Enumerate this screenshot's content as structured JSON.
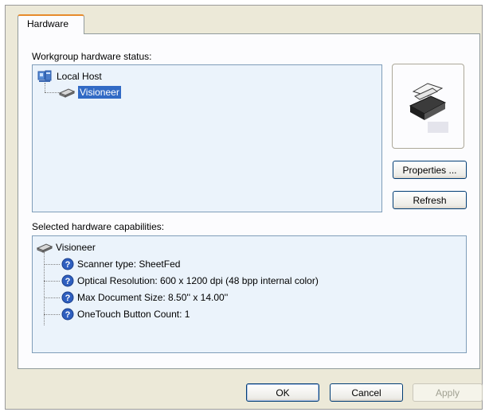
{
  "tabs": [
    {
      "label": "Hardware"
    }
  ],
  "status_section": {
    "label": "Workgroup hardware status:",
    "tree": {
      "root": {
        "label": "Local Host",
        "icon": "network-host-icon"
      },
      "child": {
        "label": "Visioneer",
        "icon": "scanner-icon"
      }
    }
  },
  "device_image": {
    "icon": "sheetfed-scanner-icon"
  },
  "side_buttons": {
    "properties": "Properties ...",
    "refresh": "Refresh"
  },
  "capabilities_section": {
    "label": "Selected hardware capabilities:",
    "root": {
      "label": "Visioneer",
      "icon": "scanner-icon"
    },
    "items": [
      {
        "label": "Scanner type: SheetFed",
        "icon": "help-icon"
      },
      {
        "label": "Optical Resolution: 600 x 1200 dpi (48 bpp internal color)",
        "icon": "help-icon"
      },
      {
        "label": "Max Document Size:  8.50'' x 14.00''",
        "icon": "help-icon"
      },
      {
        "label": "OneTouch Button Count: 1",
        "icon": "help-icon"
      }
    ]
  },
  "dialog_buttons": {
    "ok": "OK",
    "cancel": "Cancel",
    "apply": "Apply"
  },
  "colors": {
    "selection": "#316ac5",
    "dialog_bg": "#ece9d8",
    "tab_highlight": "#e68b2c"
  }
}
